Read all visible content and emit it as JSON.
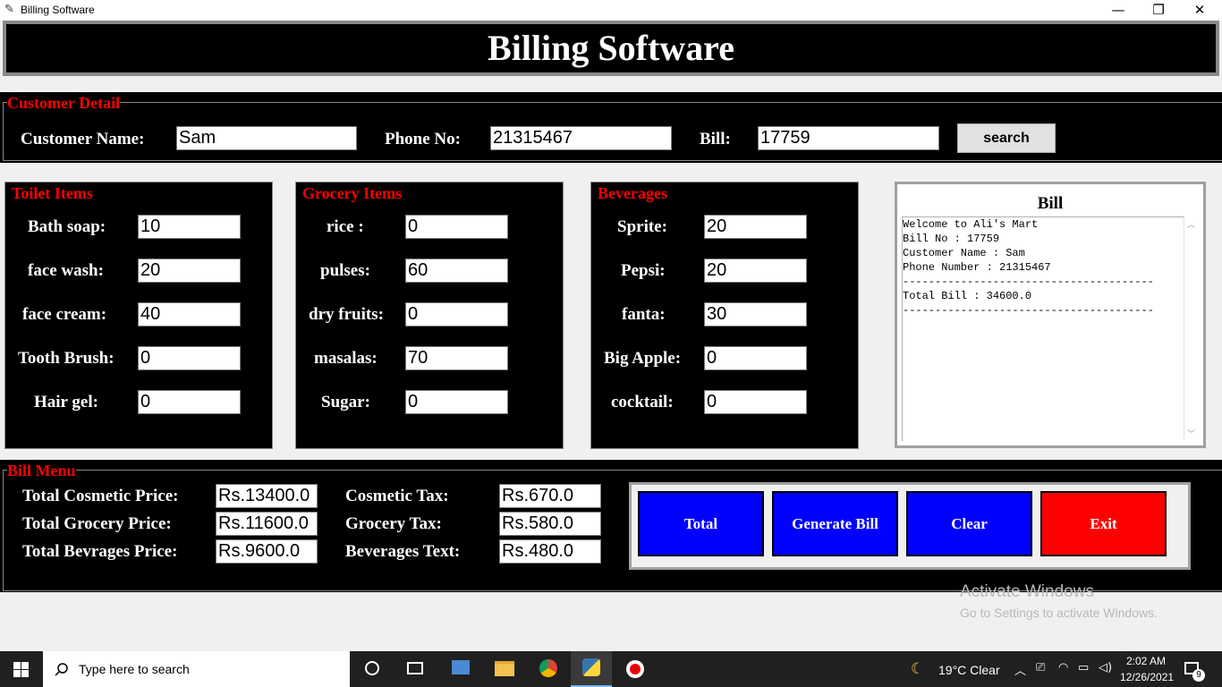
{
  "window": {
    "title": "Billing Software",
    "minimize": "—",
    "maximize": "❐",
    "close": "✕"
  },
  "heading": "Billing Software",
  "customer": {
    "legend": "Customer Detail",
    "name_label": "Customer Name:",
    "name_value": "Sam",
    "phone_label": "Phone No:",
    "phone_value": "21315467",
    "bill_label": "Bill:",
    "bill_value": "17759",
    "search_label": "search"
  },
  "toilet": {
    "legend": "Toilet Items",
    "items": [
      {
        "label": "Bath soap:",
        "value": "10"
      },
      {
        "label": "face wash:",
        "value": "20"
      },
      {
        "label": "face cream:",
        "value": "40"
      },
      {
        "label": "Tooth Brush:",
        "value": "0"
      },
      {
        "label": "Hair gel:",
        "value": "0"
      }
    ]
  },
  "grocery": {
    "legend": "Grocery Items",
    "items": [
      {
        "label": "rice :",
        "value": "0"
      },
      {
        "label": "pulses:",
        "value": "60"
      },
      {
        "label": "dry fruits:",
        "value": "0"
      },
      {
        "label": "masalas:",
        "value": "70"
      },
      {
        "label": "Sugar:",
        "value": "0"
      }
    ]
  },
  "beverages": {
    "legend": "Beverages",
    "items": [
      {
        "label": "Sprite:",
        "value": "20"
      },
      {
        "label": "Pepsi:",
        "value": "20"
      },
      {
        "label": "fanta:",
        "value": "30"
      },
      {
        "label": "Big Apple:",
        "value": "0"
      },
      {
        "label": "cocktail:",
        "value": "0"
      }
    ]
  },
  "bill": {
    "title": "Bill",
    "text": "Welcome to Ali's Mart\nBill No : 17759\nCustomer Name : Sam\nPhone Number : 21315467\n---------------------------------------\nTotal Bill : 34600.0\n---------------------------------------"
  },
  "bill_menu": {
    "legend": "Bill Menu",
    "cosmetic_price_label": "Total Cosmetic Price:",
    "cosmetic_price_value": "Rs.13400.0",
    "grocery_price_label": "Total Grocery Price:",
    "grocery_price_value": "Rs.11600.0",
    "bevrages_price_label": "Total Bevrages Price:",
    "bevrages_price_value": "Rs.9600.0",
    "cosmetic_tax_label": "Cosmetic Tax:",
    "cosmetic_tax_value": "Rs.670.0",
    "grocery_tax_label": "Grocery Tax:",
    "grocery_tax_value": "Rs.580.0",
    "beverages_tax_label": "Beverages Text:",
    "beverages_tax_value": "Rs.480.0",
    "buttons": {
      "total": "Total",
      "generate": "Generate Bill",
      "clear": "Clear",
      "exit": "Exit"
    },
    "colors": {
      "blue": "#0000ff",
      "red": "#ff0000"
    }
  },
  "watermark": {
    "line1": "Activate Windows",
    "line2": "Go to Settings to activate Windows."
  },
  "taskbar": {
    "search_placeholder": "Type here to search",
    "weather": "19°C  Clear",
    "time": "2:02 AM",
    "date": "12/26/2021",
    "notifications": "9",
    "icons": [
      "windows-start-icon",
      "search-icon",
      "cortana-icon",
      "task-view-icon",
      "network-app-icon",
      "file-explorer-icon",
      "chrome-icon",
      "python-icon",
      "record-icon"
    ]
  }
}
